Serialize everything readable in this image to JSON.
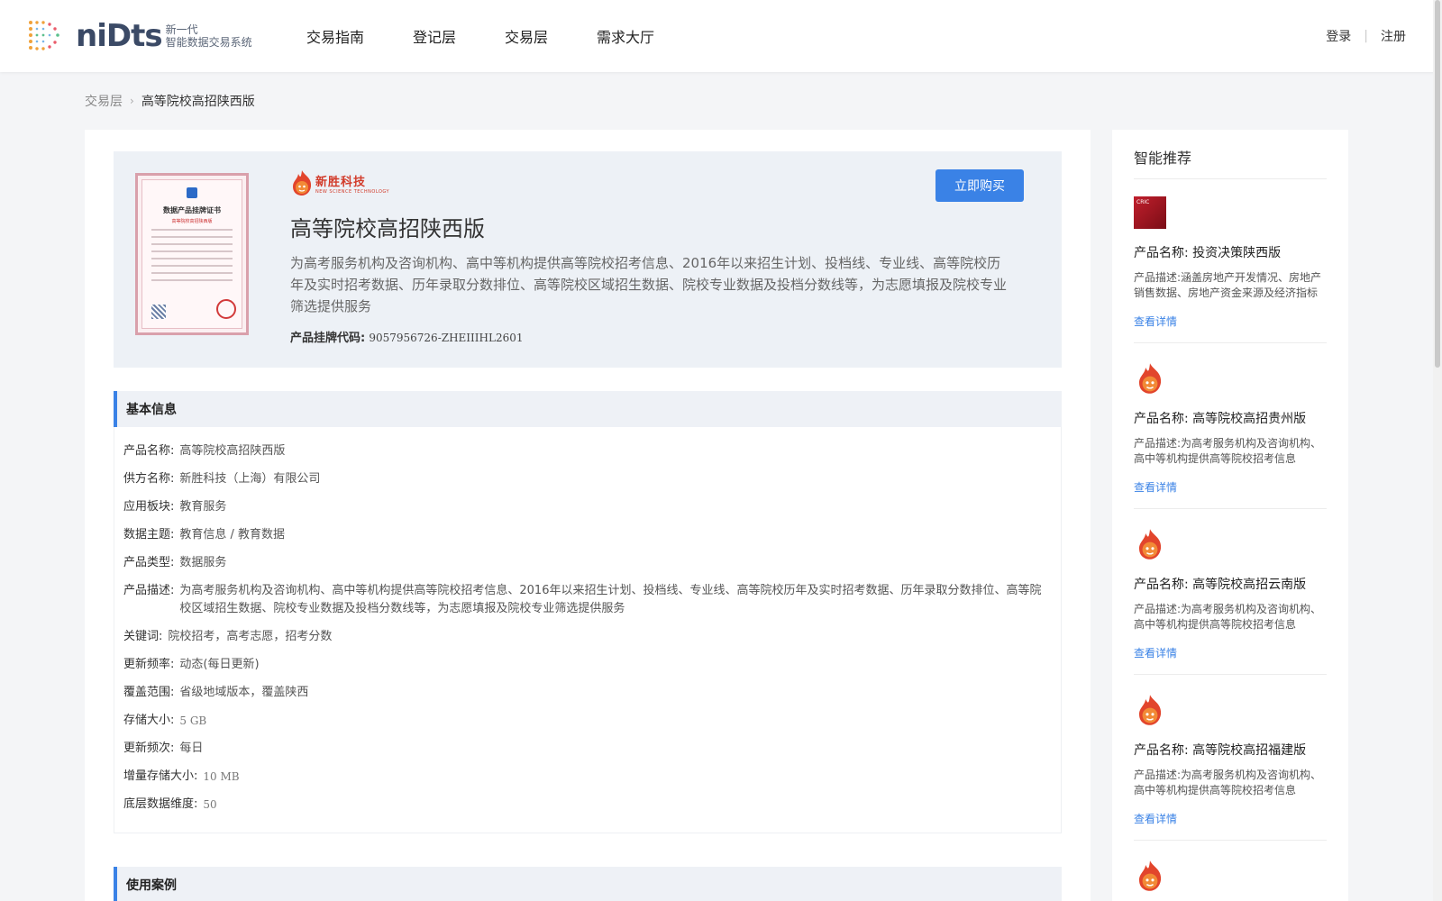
{
  "header": {
    "logo_word": "niDts",
    "logo_line1": "新一代",
    "logo_line2": "智能数据交易系统",
    "nav": [
      "交易指南",
      "登记层",
      "交易层",
      "需求大厅"
    ],
    "login": "登录",
    "register": "注册"
  },
  "breadcrumb": {
    "parent": "交易层",
    "current": "高等院校高招陕西版"
  },
  "product": {
    "certificate_title": "数据产品挂牌证书",
    "certificate_subtitle": "高等院校高招陕西版",
    "brand_cn": "新胜科技",
    "brand_en": "NEW SCIENCE TECHNOLOGY",
    "title": "高等院校高招陕西版",
    "description": "为高考服务机构及咨询机构、高中等机构提供高等院校招考信息、2016年以来招生计划、投档线、专业线、高等院校历年及实时招考数据、历年录取分数排位、高等院校区域招生数据、院校专业数据及投档分数线等，为志愿填报及院校专业筛选提供服务",
    "code_label": "产品挂牌代码:",
    "code_value": "9057956726-ZHEIIIHL2601",
    "buy_label": "立即购买"
  },
  "basic_info": {
    "title": "基本信息",
    "rows": [
      {
        "k": "产品名称:",
        "v": "高等院校高招陕西版"
      },
      {
        "k": "供方名称:",
        "v": "新胜科技（上海）有限公司"
      },
      {
        "k": "应用板块:",
        "v": "教育服务"
      },
      {
        "k": "数据主题:",
        "v": "教育信息 / 教育数据"
      },
      {
        "k": "产品类型:",
        "v": "数据服务"
      },
      {
        "k": "产品描述:",
        "v": "为高考服务机构及咨询机构、高中等机构提供高等院校招考信息、2016年以来招生计划、投档线、专业线、高等院校历年及实时招考数据、历年录取分数排位、高等院校区域招生数据、院校专业数据及投档分数线等，为志愿填报及院校专业筛选提供服务"
      },
      {
        "k": "关键词:",
        "v": "院校招考，高考志愿，招考分数"
      },
      {
        "k": "更新频率:",
        "v": "动态(每日更新)"
      },
      {
        "k": "覆盖范围:",
        "v": "省级地域版本，覆盖陕西"
      },
      {
        "k": "存储大小:",
        "v": "5 GB"
      },
      {
        "k": "更新频次:",
        "v": "每日"
      },
      {
        "k": "增量存储大小:",
        "v": "10 MB"
      },
      {
        "k": "底层数据维度:",
        "v": "50"
      }
    ]
  },
  "use_cases": {
    "title": "使用案例"
  },
  "recommend": {
    "title": "智能推荐",
    "name_prefix": "产品名称:",
    "desc_prefix": "产品描述:",
    "link_label": "查看详情",
    "cric_label": "CRIC",
    "items": [
      {
        "name": "投资决策陕西版",
        "desc": "涵盖房地产开发情况、房地产销售数据、房地产资金来源及经济指标等数据"
      },
      {
        "name": "高等院校高招贵州版",
        "desc": "为高考服务机构及咨询机构、高中等机构提供高等院校招考信息"
      },
      {
        "name": "高等院校高招云南版",
        "desc": "为高考服务机构及咨询机构、高中等机构提供高等院校招考信息"
      },
      {
        "name": "高等院校高招福建版",
        "desc": "为高考服务机构及咨询机构、高中等机构提供高等院校招考信息"
      }
    ]
  },
  "colors": {
    "accent": "#3a82e6",
    "brand": "#d23b2a",
    "logo": "#3b4a66"
  }
}
